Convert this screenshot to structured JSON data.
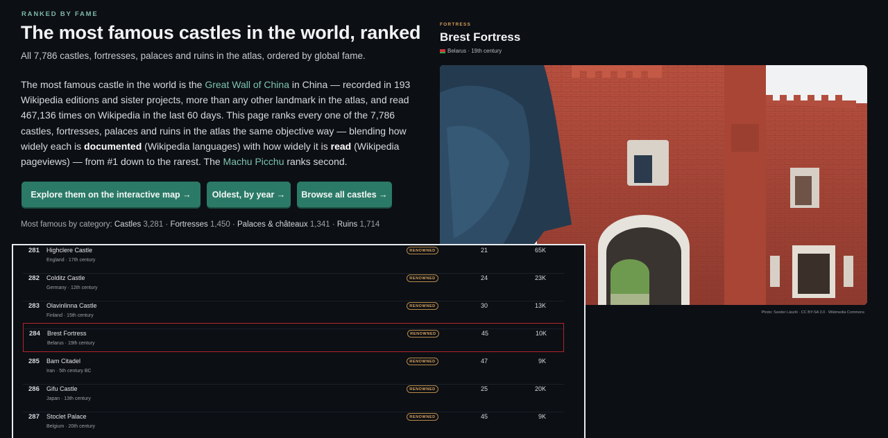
{
  "header": {
    "eyebrow": "RANKED BY FAME",
    "title": "The most famous castles in the world, ranked",
    "subtitle": "All 7,786 castles, fortresses, palaces and ruins in the atlas, ordered by global fame."
  },
  "intro": {
    "p1": "The most famous castle in the world is the ",
    "link1": "Great Wall of China",
    "p2": " in China — recorded in 193 Wikipedia editions and sister projects, more than any other landmark in the atlas, and read 467,136 times on Wikipedia in the last 60 days. This page ranks every one of the 7,786 castles, fortresses, palaces and ruins in the atlas the same objective way — blending how widely each is ",
    "b1": "documented",
    "p3": " (Wikipedia languages) with how widely it is ",
    "b2": "read",
    "p4": " (Wikipedia pageviews) — from #1 down to the rarest. The ",
    "link2": "Machu Picchu",
    "p5": " ranks second."
  },
  "buttons": {
    "map": "Explore them on the interactive map →",
    "oldest": "Oldest, by year →",
    "browse": "Browse all castles →"
  },
  "categories": {
    "prefix": "Most famous by category: ",
    "items": [
      {
        "label": "Castles",
        "count": "3,281"
      },
      {
        "label": "Fortresses",
        "count": "1,450"
      },
      {
        "label": "Palaces & châteaux",
        "count": "1,341"
      },
      {
        "label": "Ruins",
        "count": "1,714"
      }
    ]
  },
  "feature": {
    "eyebrow": "FORTRESS",
    "title": "Brest Fortress",
    "meta": "Belarus · 19th century",
    "credit": "Photo: Szeder László · CC BY-SA 3.0 · Wikimedia Commons"
  },
  "rows": [
    {
      "rank": "281",
      "name": "Highclere Castle",
      "sub": "England · 17th century",
      "badge": "RENOWNED",
      "langs": "21",
      "views": "65K"
    },
    {
      "rank": "282",
      "name": "Colditz Castle",
      "sub": "Germany · 12th century",
      "badge": "RENOWNED",
      "langs": "24",
      "views": "23K"
    },
    {
      "rank": "283",
      "name": "Olavinlinna Castle",
      "sub": "Finland · 15th century",
      "badge": "RENOWNED",
      "langs": "30",
      "views": "13K"
    },
    {
      "rank": "284",
      "name": "Brest Fortress",
      "sub": "Belarus · 19th century",
      "badge": "RENOWNED",
      "langs": "45",
      "views": "10K"
    },
    {
      "rank": "285",
      "name": "Bam Citadel",
      "sub": "Iran · 5th century BC",
      "badge": "RENOWNED",
      "langs": "47",
      "views": "9K"
    },
    {
      "rank": "286",
      "name": "Gifu Castle",
      "sub": "Japan · 13th century",
      "badge": "RENOWNED",
      "langs": "25",
      "views": "20K"
    },
    {
      "rank": "287",
      "name": "Stoclet Palace",
      "sub": "Belgium · 20th century",
      "badge": "RENOWNED",
      "langs": "45",
      "views": "9K"
    }
  ]
}
